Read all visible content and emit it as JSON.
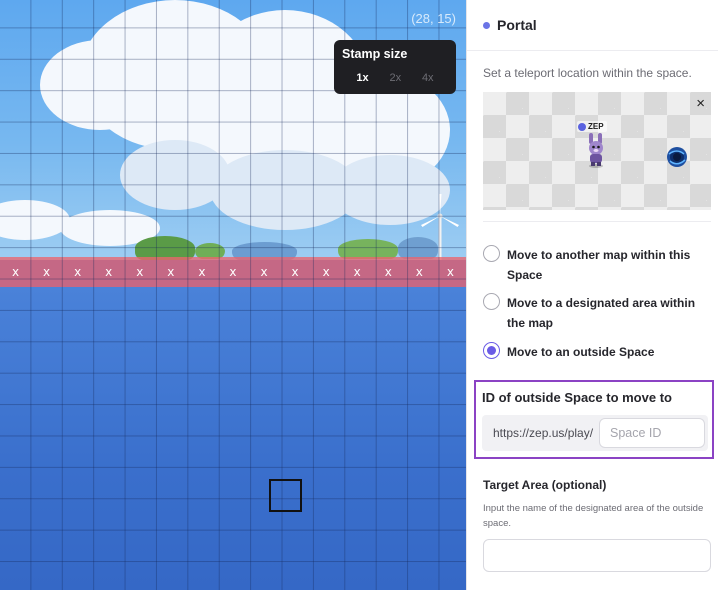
{
  "canvas": {
    "coordinate_readout": "(28, 15)",
    "blocked_marker": "x",
    "blocked_count": 15,
    "stamp_size": {
      "title": "Stamp size",
      "options": [
        "1x",
        "2x",
        "4x"
      ],
      "selected": "1x"
    }
  },
  "panel": {
    "title": "Portal",
    "description": "Set a teleport location within the space.",
    "preview": {
      "close_glyph": "×",
      "character_tag": "ZEP"
    },
    "move_options": [
      {
        "label": "Move to another map within this Space",
        "checked": false
      },
      {
        "label": "Move to a designated area within the map",
        "checked": false
      },
      {
        "label": "Move to an outside Space",
        "checked": true
      }
    ],
    "outside_space": {
      "label": "ID of outside Space to move to",
      "url_prefix": "https://zep.us/play/",
      "placeholder": "Space ID",
      "value": ""
    },
    "target_area": {
      "label": "Target Area (optional)",
      "help": "Input the name of the designated area of the outside space.",
      "value": ""
    }
  },
  "colors": {
    "accent": "#6b5ce6",
    "highlight_border": "#8b43c4",
    "blocked_tiles": "#eb646e",
    "sea": "#3f78d6"
  }
}
